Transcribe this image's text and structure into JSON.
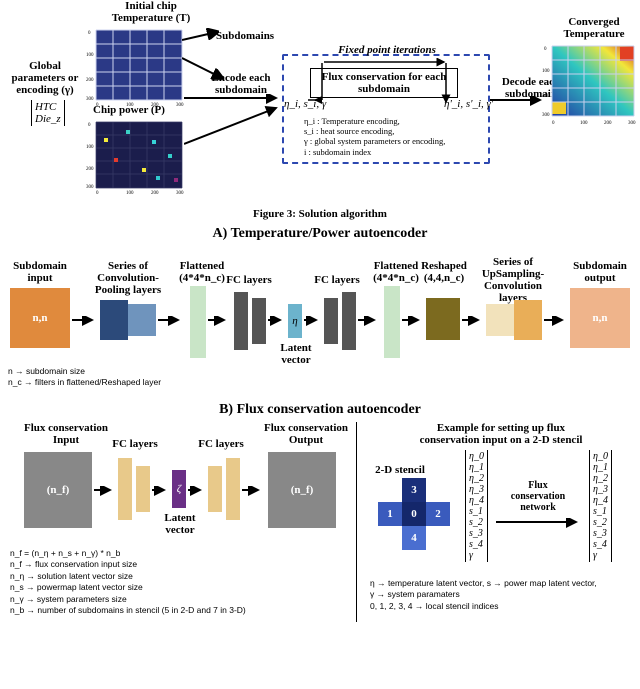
{
  "top": {
    "title_T": "Initial chip\nTemperature (T)",
    "title_P": "Chip power (P)",
    "global_label": "Global\nparameters or\nencoding (γ)",
    "global_vec_rows": [
      "HTC",
      "Die_z"
    ],
    "subdomains": "Subdomains",
    "encode_each": "Encode each\nsubdomain",
    "fpi": "Fixed point iterations",
    "flux_box": "Flux conservation for each\nsubdomain",
    "decode_each": "Decode each\nsubdomain",
    "converged": "Converged\nTemperature",
    "latent_left": "η_i, s_i, γ",
    "latent_right": "η'_i, s'_i, γ'",
    "legend_lines": [
      "η_i : Temperature encoding,",
      "s_i : heat source encoding,",
      "γ : global system parameters or encoding,",
      "i : subdomain index"
    ]
  },
  "fig3": "Figure 3: Solution algorithm",
  "secA": "A) Temperature/Power autoencoder",
  "ae": {
    "sub_in": "Subdomain\ninput",
    "nn": "n,n",
    "conv": "Series of\nConvolution-\nPooling layers",
    "flatten1": "Flattened\n(4*4*n_c)",
    "fc": "FC layers",
    "latent": "Latent\nvector",
    "eta": "η",
    "flatten2": "Flattened\n(4*4*n_c)",
    "reshape": "Reshaped\n(4,4,n_c)",
    "upsamp": "Series of\nUpSampling-\nConvolution layers",
    "sub_out": "Subdomain\noutput",
    "foot1": "n → subdomain size",
    "foot2": "n_c → filters in flattened/Reshaped layer"
  },
  "secB": "B) Flux conservation autoencoder",
  "flux": {
    "in_lbl": "Flux conservation\nInput",
    "nf": "(n_f)",
    "fc": "FC layers",
    "latent": "Latent\nvector",
    "zeta": "ζ",
    "out_lbl": "Flux conservation\nOutput",
    "foot": [
      "n_f = (n_η + n_s + n_γ) * n_b",
      "n_f → flux conservation input size",
      "n_η → solution latent vector size",
      "n_s → powermap latent vector size",
      "n_γ → system parameters size",
      "n_b → number of subdomains in stencil (5 in 2-D and 7 in 3-D)"
    ],
    "ex_title": "Example for setting up flux\nconservation input on a 2-D stencil",
    "stencil_lbl": "2-D stencil",
    "stencil_nums": [
      "3",
      "1",
      "0",
      "2",
      "4"
    ],
    "arrow_lbl": "Flux\nconservation\nnetwork",
    "mat_in": [
      "η_0",
      "η_1",
      "η_2",
      "η_3",
      "η_4",
      "s_1",
      "s_2",
      "s_3",
      "s_4",
      "γ"
    ],
    "mat_out": [
      "η_0",
      "η_1",
      "η_2",
      "η_3",
      "η_4",
      "s_1",
      "s_2",
      "s_3",
      "s_4",
      "γ"
    ],
    "legend": [
      "η → temperature latent vector,  s → power map latent vector,",
      "γ → system paramaters",
      "0, 1, 2, 3, 4 → local stencil indices"
    ]
  }
}
